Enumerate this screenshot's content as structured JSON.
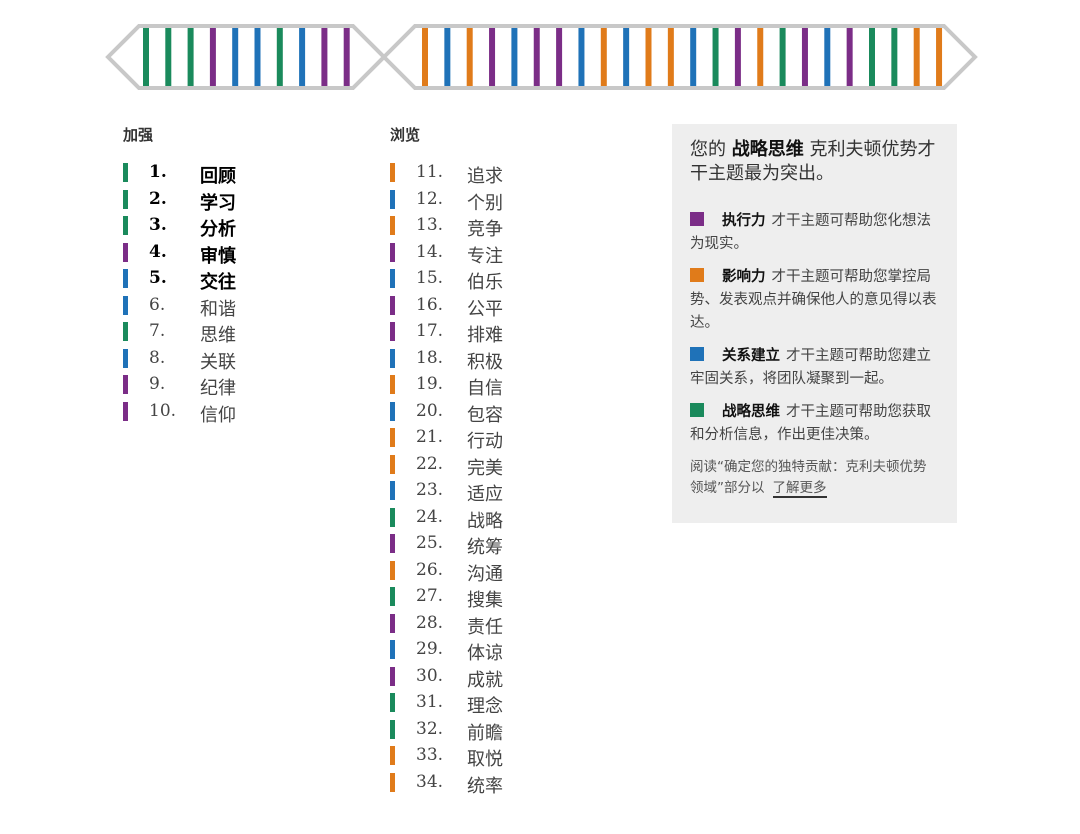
{
  "colors": {
    "executing": "#7b2d87",
    "influencing": "#e07b1a",
    "relationship": "#1f72b8",
    "strategic": "#1a8a5c",
    "strip_outline": "#c8c8c8"
  },
  "strip": {
    "left_group": [
      "strategic",
      "strategic",
      "strategic",
      "executing",
      "relationship",
      "relationship",
      "strategic",
      "relationship",
      "executing",
      "executing"
    ],
    "right_group": [
      "influencing",
      "relationship",
      "influencing",
      "executing",
      "relationship",
      "executing",
      "executing",
      "relationship",
      "influencing",
      "relationship",
      "influencing",
      "influencing",
      "relationship",
      "strategic",
      "executing",
      "influencing",
      "strategic",
      "executing",
      "relationship",
      "executing",
      "strategic",
      "strategic",
      "influencing",
      "influencing"
    ]
  },
  "columns": {
    "strengthen": {
      "title": "加强",
      "items": [
        {
          "num": "1.",
          "name": "回顾",
          "domain": "strategic",
          "strong": true
        },
        {
          "num": "2.",
          "name": "学习",
          "domain": "strategic",
          "strong": true
        },
        {
          "num": "3.",
          "name": "分析",
          "domain": "strategic",
          "strong": true
        },
        {
          "num": "4.",
          "name": "审慎",
          "domain": "executing",
          "strong": true
        },
        {
          "num": "5.",
          "name": "交往",
          "domain": "relationship",
          "strong": true
        },
        {
          "num": "6.",
          "name": "和谐",
          "domain": "relationship",
          "strong": false
        },
        {
          "num": "7.",
          "name": "思维",
          "domain": "strategic",
          "strong": false
        },
        {
          "num": "8.",
          "name": "关联",
          "domain": "relationship",
          "strong": false
        },
        {
          "num": "9.",
          "name": "纪律",
          "domain": "executing",
          "strong": false
        },
        {
          "num": "10.",
          "name": "信仰",
          "domain": "executing",
          "strong": false
        }
      ]
    },
    "browse": {
      "title": "浏览",
      "items": [
        {
          "num": "11.",
          "name": "追求",
          "domain": "influencing"
        },
        {
          "num": "12.",
          "name": "个别",
          "domain": "relationship"
        },
        {
          "num": "13.",
          "name": "竞争",
          "domain": "influencing"
        },
        {
          "num": "14.",
          "name": "专注",
          "domain": "executing"
        },
        {
          "num": "15.",
          "name": "伯乐",
          "domain": "relationship"
        },
        {
          "num": "16.",
          "name": "公平",
          "domain": "executing"
        },
        {
          "num": "17.",
          "name": "排难",
          "domain": "executing"
        },
        {
          "num": "18.",
          "name": "积极",
          "domain": "relationship"
        },
        {
          "num": "19.",
          "name": "自信",
          "domain": "influencing"
        },
        {
          "num": "20.",
          "name": "包容",
          "domain": "relationship"
        },
        {
          "num": "21.",
          "name": "行动",
          "domain": "influencing"
        },
        {
          "num": "22.",
          "name": "完美",
          "domain": "influencing"
        },
        {
          "num": "23.",
          "name": "适应",
          "domain": "relationship"
        },
        {
          "num": "24.",
          "name": "战略",
          "domain": "strategic"
        },
        {
          "num": "25.",
          "name": "统筹",
          "domain": "executing"
        },
        {
          "num": "26.",
          "name": "沟通",
          "domain": "influencing"
        },
        {
          "num": "27.",
          "name": "搜集",
          "domain": "strategic"
        },
        {
          "num": "28.",
          "name": "责任",
          "domain": "executing"
        },
        {
          "num": "29.",
          "name": "体谅",
          "domain": "relationship"
        },
        {
          "num": "30.",
          "name": "成就",
          "domain": "executing"
        },
        {
          "num": "31.",
          "name": "理念",
          "domain": "strategic"
        },
        {
          "num": "32.",
          "name": "前瞻",
          "domain": "strategic"
        },
        {
          "num": "33.",
          "name": "取悦",
          "domain": "influencing"
        },
        {
          "num": "34.",
          "name": "统率",
          "domain": "influencing"
        }
      ]
    }
  },
  "panel": {
    "intro_prefix": "您的 ",
    "intro_bold": "战略思维",
    "intro_suffix": " 克利夫顿优势才干主题最为突出。",
    "domains": [
      {
        "key": "executing",
        "name": "执行力",
        "text": "才干主题可帮助您化想法为现实。"
      },
      {
        "key": "influencing",
        "name": "影响力",
        "text": "才干主题可帮助您掌控局势、发表观点并确保他人的意见得以表达。"
      },
      {
        "key": "relationship",
        "name": "关系建立",
        "text": "才干主题可帮助您建立牢固关系，将团队凝聚到一起。"
      },
      {
        "key": "strategic",
        "name": "战略思维",
        "text": "才干主题可帮助您获取和分析信息，作出更佳决策。"
      }
    ],
    "read_text": "阅读“确定您的独特贡献：克利夫顿优势领域”部分以",
    "learn_more": "了解更多"
  }
}
